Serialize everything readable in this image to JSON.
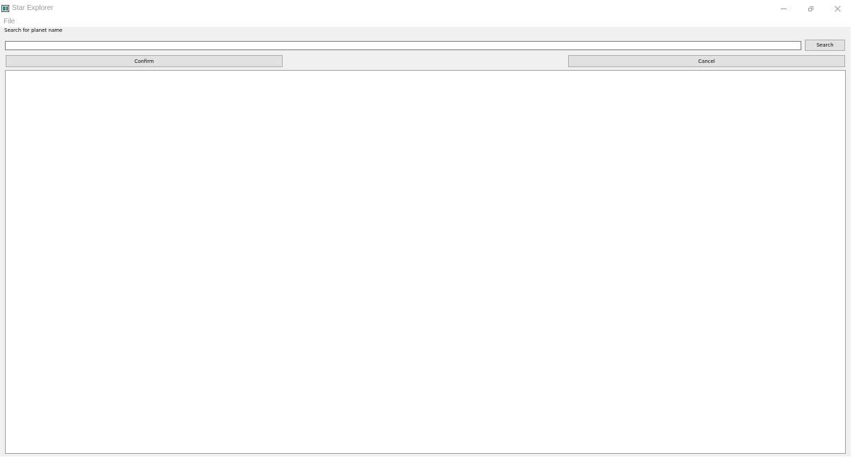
{
  "window": {
    "title": "Star Explorer",
    "icon": "app-window-icon"
  },
  "menubar": {
    "items": [
      {
        "label": "File"
      }
    ]
  },
  "search": {
    "label": "Search for planet name",
    "value": "",
    "placeholder": "",
    "button_label": "Search"
  },
  "actions": {
    "confirm_label": "Confirm",
    "cancel_label": "Cancel"
  },
  "results": {
    "items": []
  },
  "colors": {
    "client_background": "#f0f0f0",
    "button_background": "#e1e1e1",
    "button_border": "#adadad",
    "title_text": "#9a9a9a"
  }
}
